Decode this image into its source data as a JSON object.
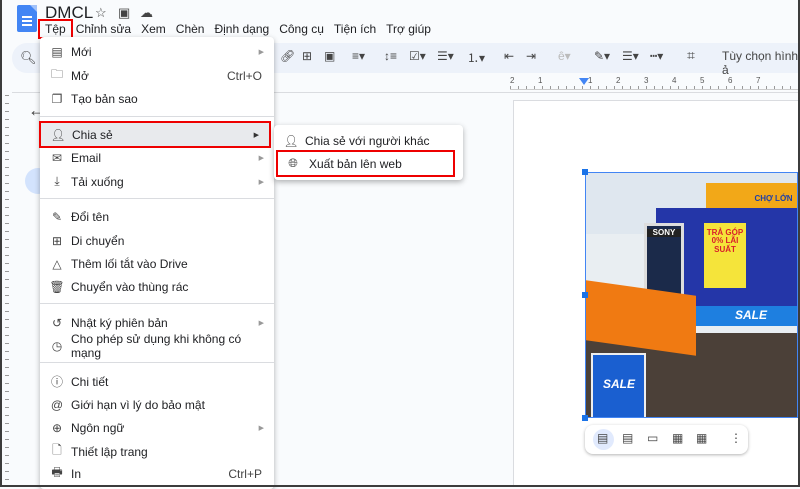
{
  "doc": {
    "title": "DMCL"
  },
  "menubar": [
    "Tệp",
    "Chỉnh sửa",
    "Xem",
    "Chèn",
    "Định dạng",
    "Công cụ",
    "Tiện ích",
    "Trợ giúp"
  ],
  "toolbar": {
    "image_options": "Tùy chọn hình ả"
  },
  "ruler": [
    "2",
    "1",
    "1",
    "2",
    "3",
    "4",
    "5",
    "6",
    "7"
  ],
  "file_menu": [
    {
      "label": "Mới",
      "icon": "doc-icon",
      "submenu": true
    },
    {
      "label": "Mở",
      "icon": "folder-icon",
      "shortcut": "Ctrl+O"
    },
    {
      "label": "Tạo bản sao",
      "icon": "copy-icon"
    },
    {
      "label": "Chia sẻ",
      "icon": "person-add-icon",
      "submenu": true,
      "highlighted": true
    },
    {
      "label": "Email",
      "icon": "mail-icon",
      "submenu": true
    },
    {
      "label": "Tải xuống",
      "icon": "download-icon",
      "submenu": true
    },
    {
      "label": "Đổi tên",
      "icon": "pencil-icon"
    },
    {
      "label": "Di chuyển",
      "icon": "move-folder-icon"
    },
    {
      "label": "Thêm lối tắt vào Drive",
      "icon": "drive-shortcut-icon"
    },
    {
      "label": "Chuyển vào thùng rác",
      "icon": "trash-icon"
    },
    {
      "label": "Nhật ký phiên bản",
      "icon": "history-icon",
      "submenu": true
    },
    {
      "label": "Cho phép sử dụng khi không có mạng",
      "icon": "offline-icon"
    },
    {
      "label": "Chi tiết",
      "icon": "info-icon"
    },
    {
      "label": "Giới hạn vì lý do bảo mật",
      "icon": "security-icon"
    },
    {
      "label": "Ngôn ngữ",
      "icon": "globe-icon",
      "submenu": true
    },
    {
      "label": "Thiết lập trang",
      "icon": "page-setup-icon"
    },
    {
      "label": "In",
      "icon": "printer-icon",
      "shortcut": "Ctrl+P"
    }
  ],
  "share_submenu": [
    {
      "label": "Chia sẻ với người khác",
      "icon": "person-add-icon"
    },
    {
      "label": "Xuất bản lên web",
      "icon": "globe-icon",
      "highlighted": true
    }
  ],
  "photo_text": [
    "SONY",
    "TRẢ GÓP 0% LÃI SUẤT",
    "SALE",
    "CHỢ LỚN"
  ],
  "colors": {
    "accent": "#1a73e8",
    "highlight_box": "#ee0000"
  }
}
